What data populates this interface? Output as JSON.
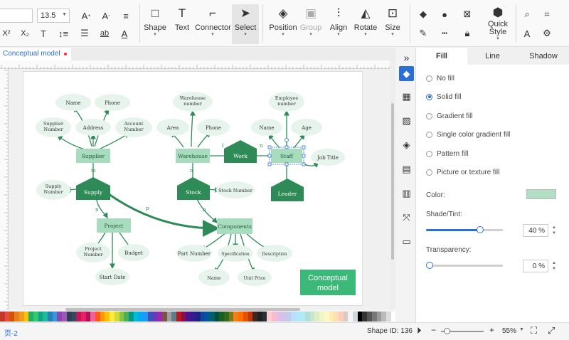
{
  "toolbar": {
    "font_name": "",
    "font_size": "13.5",
    "buttons": [
      {
        "label": "Shape",
        "icon": "square-icon"
      },
      {
        "label": "Text",
        "icon": "text-icon"
      },
      {
        "label": "Connector",
        "icon": "connector-icon"
      },
      {
        "label": "Select",
        "icon": "select-arrow-icon"
      },
      {
        "label": "Position",
        "icon": "layers-icon"
      },
      {
        "label": "Group",
        "icon": "group-icon"
      },
      {
        "label": "Align",
        "icon": "align-icon"
      },
      {
        "label": "Rotate",
        "icon": "rotate-icon"
      },
      {
        "label": "Size",
        "icon": "size-icon"
      },
      {
        "label": "Quick Style",
        "icon": "quick-style-icon"
      }
    ]
  },
  "tabs": {
    "doc_title": "Conceptual model"
  },
  "canvas": {
    "entities": [
      "Supplier",
      "Warehouse",
      "Staff",
      "Project",
      "Components"
    ],
    "relationships": [
      "Work",
      "Supply",
      "Stock",
      "Leader"
    ],
    "attributes": [
      "Name",
      "Phone",
      "Supplier Number",
      "Address",
      "Account Number",
      "Warehouse number",
      "Area",
      "Phone",
      "Employee number",
      "Name",
      "Age",
      "Job Title",
      "Supply Number",
      "Stock Number",
      "Project Number",
      "Budget",
      "Start Date",
      "Part Number",
      "Specification",
      "Description",
      "Name",
      "Unit Price"
    ],
    "cardinality": [
      "m",
      "n",
      "n",
      "1",
      "p",
      "n",
      "n"
    ],
    "title_box": "Conceptual model",
    "colors": {
      "entity": "#a8dcbf",
      "relationship": "#2e8b57",
      "attribute": "#e6f4ec",
      "title": "#3cb878"
    }
  },
  "panel": {
    "tabs": [
      "Fill",
      "Line",
      "Shadow"
    ],
    "active_tab": "Fill",
    "fill_options": [
      "No fill",
      "Solid fill",
      "Gradient fill",
      "Single color gradient fill",
      "Pattern fill",
      "Picture or texture fill"
    ],
    "selected_fill": "Solid fill",
    "color_label": "Color:",
    "color_value": "#b2dfc4",
    "shade_label": "Shade/Tint:",
    "shade_value": "40 %",
    "shade_fraction": 0.7,
    "transparency_label": "Transparency:",
    "transparency_value": "0 %",
    "transparency_fraction": 0.0
  },
  "status": {
    "page_label": "页-2",
    "shape_id": "Shape ID: 136",
    "zoom": "55%"
  }
}
